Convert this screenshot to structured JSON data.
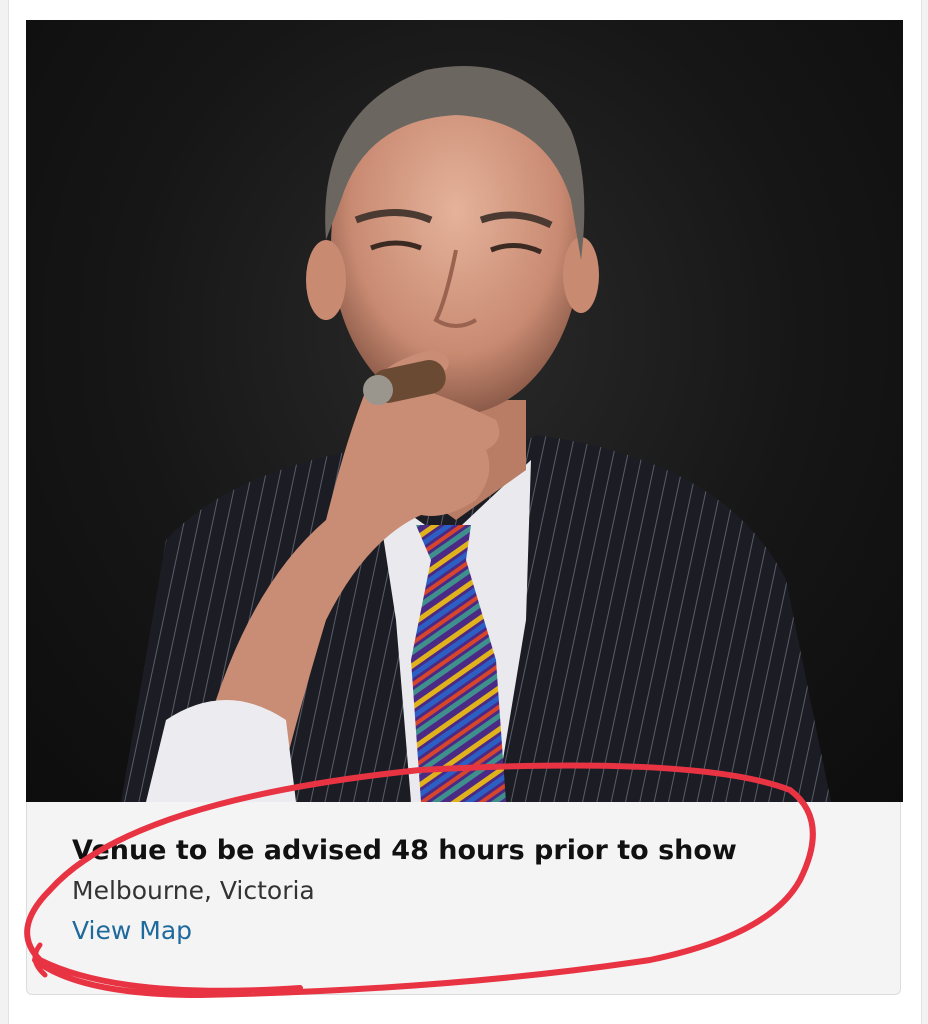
{
  "event": {
    "venue_title": "Venue to be advised 48 hours prior to show",
    "location": "Melbourne, Victoria",
    "map_link_label": "View Map"
  },
  "hero_image": {
    "subject": "portrait of a man in a pinstripe suit with a striped tie, holding a cigar"
  },
  "colors": {
    "link": "#1e6a9c",
    "annotation": "#e83343",
    "info_background": "#f4f4f4"
  }
}
